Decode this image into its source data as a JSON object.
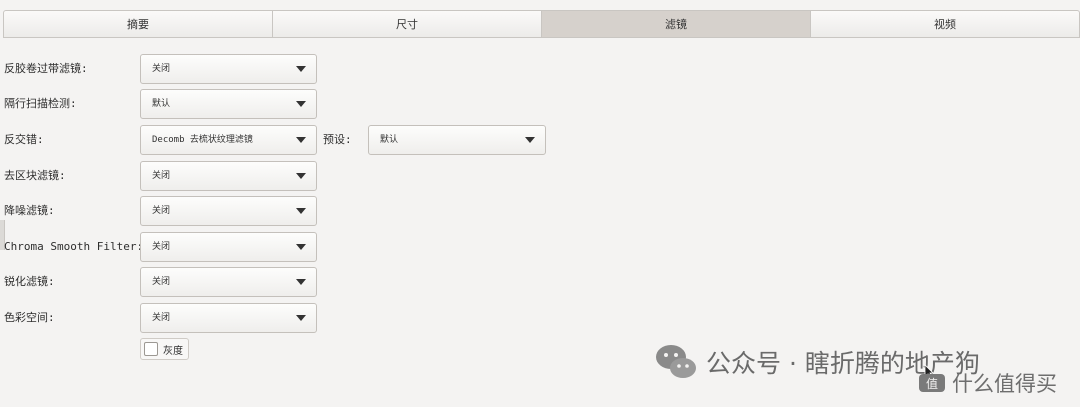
{
  "tabs": [
    {
      "label": "摘要",
      "active": false
    },
    {
      "label": "尺寸",
      "active": false
    },
    {
      "label": "滤镜",
      "active": true
    },
    {
      "label": "视频",
      "active": false
    }
  ],
  "filters": {
    "detelecine": {
      "label": "反胶卷过带滤镜:",
      "value": "关闭"
    },
    "interlace_detect": {
      "label": "隔行扫描检测:",
      "value": "默认"
    },
    "deinterlace": {
      "label": "反交错:",
      "value": "Decomb 去梳状纹理滤镜",
      "preset_label": "预设:",
      "preset_value": "默认"
    },
    "deblock": {
      "label": "去区块滤镜:",
      "value": "关闭"
    },
    "denoise": {
      "label": "降噪滤镜:",
      "value": "关闭"
    },
    "chroma_smooth": {
      "label": "Chroma Smooth Filter:",
      "value": "关闭"
    },
    "sharpen": {
      "label": "锐化滤镜:",
      "value": "关闭"
    },
    "colorspace": {
      "label": "色彩空间:",
      "value": "关闭"
    },
    "grayscale": {
      "label": "灰度",
      "checked": false
    }
  },
  "watermark": {
    "text": "公众号 · 瞎折腾的地产狗",
    "sub_text": "什么值得买"
  },
  "colors": {
    "active_tab": "#d6d1cc",
    "background": "#f4f3f2"
  }
}
